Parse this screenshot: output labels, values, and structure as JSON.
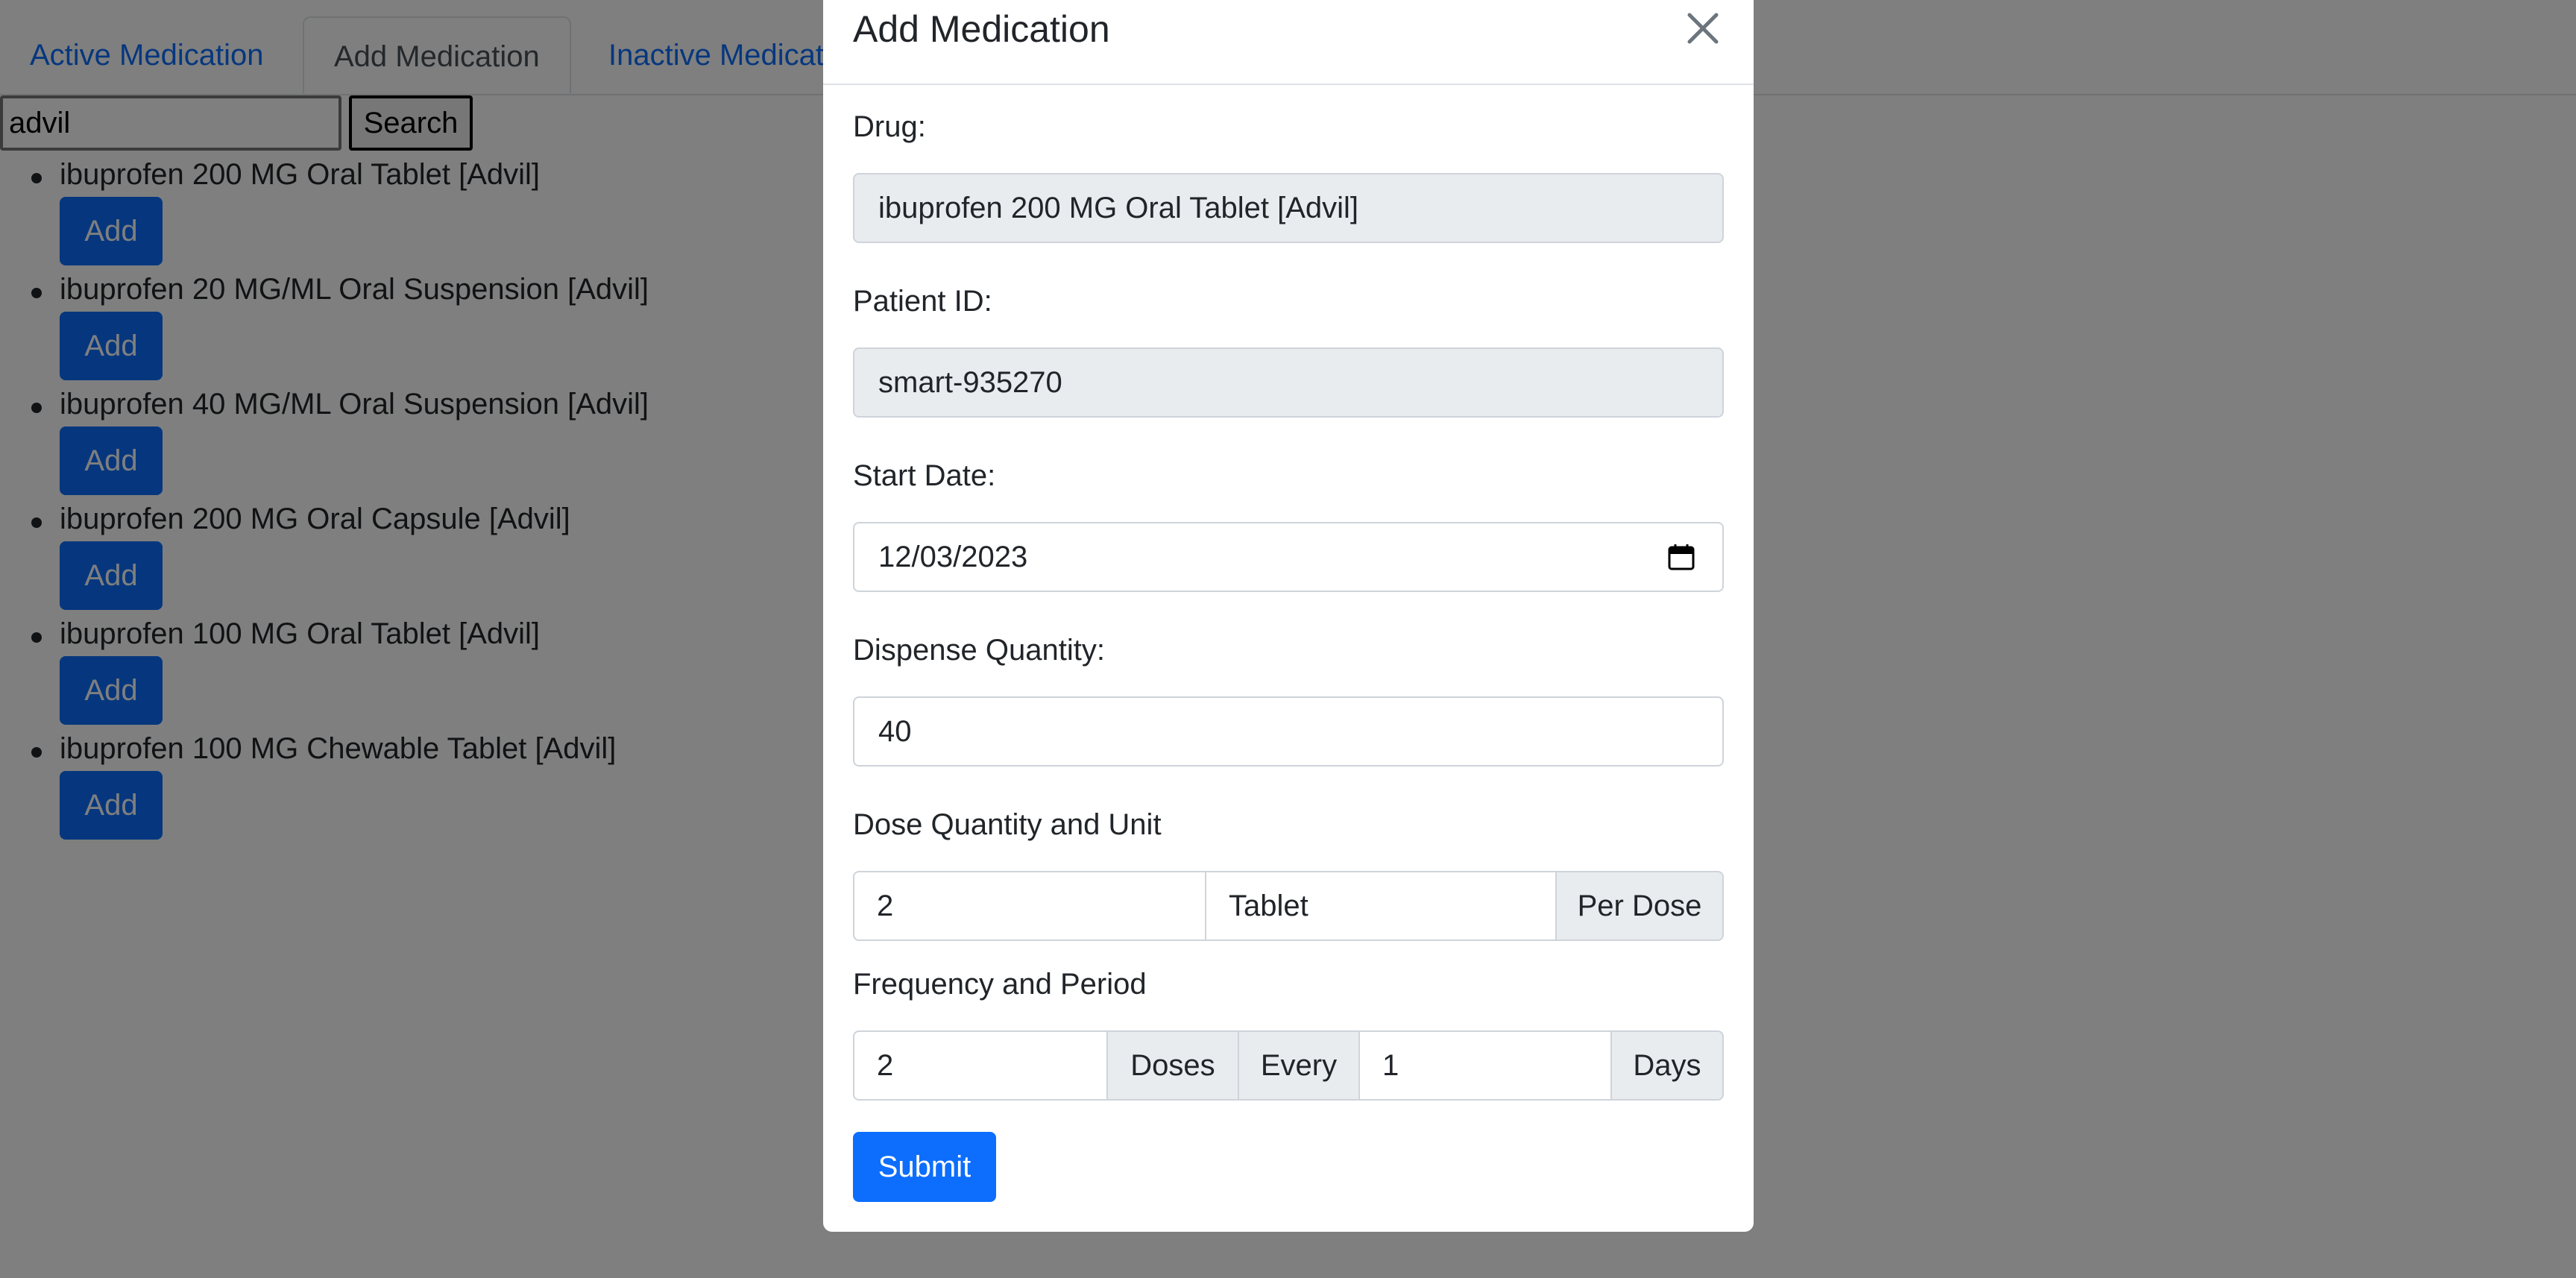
{
  "tabs": [
    {
      "label": "Active Medication"
    },
    {
      "label": "Add Medication"
    },
    {
      "label": "Inactive Medicati"
    }
  ],
  "search": {
    "value": "advil",
    "button_label": "Search"
  },
  "results": [
    {
      "name": "ibuprofen 200 MG Oral Tablet [Advil]",
      "button_label": "Add"
    },
    {
      "name": "ibuprofen 20 MG/ML Oral Suspension [Advil]",
      "button_label": "Add"
    },
    {
      "name": "ibuprofen 40 MG/ML Oral Suspension [Advil]",
      "button_label": "Add"
    },
    {
      "name": "ibuprofen 200 MG Oral Capsule [Advil]",
      "button_label": "Add"
    },
    {
      "name": "ibuprofen 100 MG Oral Tablet [Advil]",
      "button_label": "Add"
    },
    {
      "name": "ibuprofen 100 MG Chewable Tablet [Advil]",
      "button_label": "Add"
    }
  ],
  "modal": {
    "title": "Add Medication",
    "close_icon": "close-icon",
    "drug": {
      "label": "Drug:",
      "value": "ibuprofen 200 MG Oral Tablet [Advil]"
    },
    "patient": {
      "label": "Patient ID:",
      "value": "smart-935270"
    },
    "start_date": {
      "label": "Start Date:",
      "value": "12/03/2023",
      "icon": "calendar-icon"
    },
    "dispense": {
      "label": "Dispense Quantity:",
      "value": "40"
    },
    "dose": {
      "label": "Dose Quantity and Unit",
      "quantity": "2",
      "unit": "Tablet",
      "suffix": "Per Dose"
    },
    "frequency": {
      "label": "Frequency and Period",
      "count": "2",
      "count_unit": "Doses",
      "every": "Every",
      "period": "1",
      "period_unit": "Days"
    },
    "submit_label": "Submit"
  },
  "colors": {
    "primary": "#0d6efd",
    "readonly_bg": "#e9ecef",
    "border": "#ced4da",
    "backdrop": "rgba(0,0,0,0.5)"
  }
}
